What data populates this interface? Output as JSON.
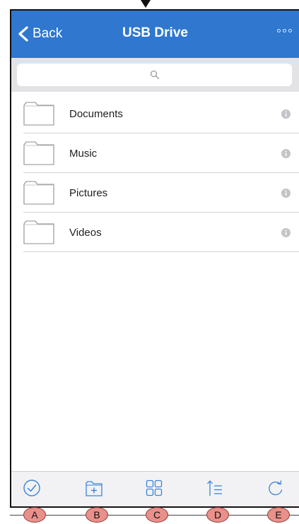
{
  "nav": {
    "back_label": "Back",
    "title": "USB Drive"
  },
  "search": {
    "placeholder": "",
    "icon": "magnifier"
  },
  "folders": [
    {
      "name": "Documents"
    },
    {
      "name": "Music"
    },
    {
      "name": "Pictures"
    },
    {
      "name": "Videos"
    }
  ],
  "toolbar": {
    "buttons": [
      {
        "icon": "checkmark-circle",
        "badge": "A"
      },
      {
        "icon": "new-folder",
        "badge": "B"
      },
      {
        "icon": "grid-view",
        "badge": "C"
      },
      {
        "icon": "sort-list",
        "badge": "D"
      },
      {
        "icon": "refresh",
        "badge": "E"
      }
    ]
  },
  "colors": {
    "nav_bar": "#2f77cf",
    "search_bar": "#e3e3e6",
    "toolbar_icon": "#3a84d9",
    "badge_fill": "#e9908b"
  }
}
